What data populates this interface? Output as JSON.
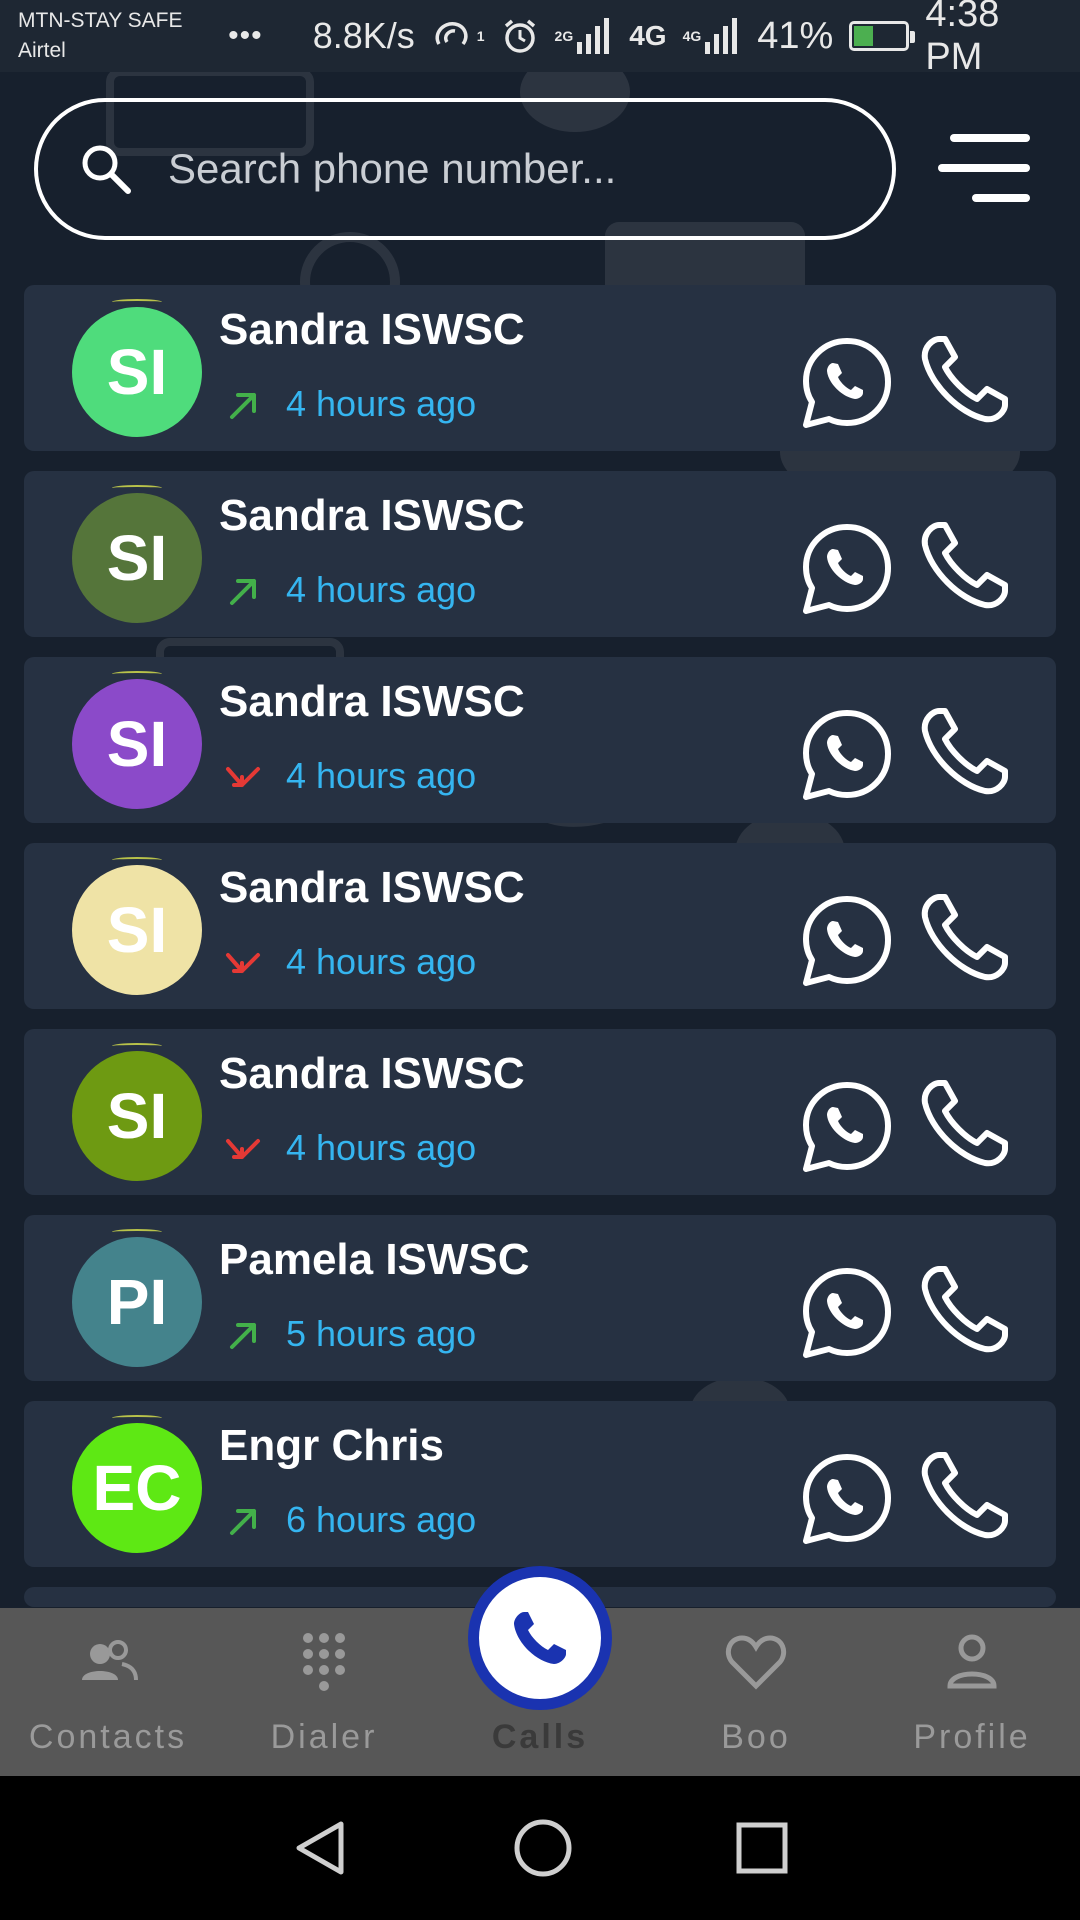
{
  "status_bar": {
    "carrier_line1": "MTN-STAY SAFE",
    "carrier_line2": "Airtel",
    "dots": "•••",
    "speed": "8.8K/s",
    "sim_badge": "1",
    "net1": "2G",
    "net2": "4G",
    "net3": "4G",
    "battery": "41%",
    "battery_level": 0.41,
    "time": "4:38 PM"
  },
  "search": {
    "placeholder": "Search phone number..."
  },
  "calls": [
    {
      "initials": "SI",
      "name": "Sandra ISWSC",
      "time": "4 hours ago",
      "direction": "outgoing",
      "avatar_color": "#4fdc7c"
    },
    {
      "initials": "SI",
      "name": "Sandra ISWSC",
      "time": "4 hours ago",
      "direction": "outgoing",
      "avatar_color": "#55753a"
    },
    {
      "initials": "SI",
      "name": "Sandra ISWSC",
      "time": "4 hours ago",
      "direction": "missed",
      "avatar_color": "#8b4ac9"
    },
    {
      "initials": "SI",
      "name": "Sandra ISWSC",
      "time": "4 hours ago",
      "direction": "missed",
      "avatar_color": "#efe3a6"
    },
    {
      "initials": "SI",
      "name": "Sandra ISWSC",
      "time": "4 hours ago",
      "direction": "missed",
      "avatar_color": "#6e9a12"
    },
    {
      "initials": "PI",
      "name": "Pamela ISWSC",
      "time": "5 hours ago",
      "direction": "outgoing",
      "avatar_color": "#44838c"
    },
    {
      "initials": "EC",
      "name": "Engr Chris",
      "time": "6 hours ago",
      "direction": "outgoing",
      "avatar_color": "#5ee814"
    }
  ],
  "colors": {
    "outgoing": "#43b04a",
    "missed": "#e53935",
    "time_text": "#35b5f0",
    "fab_ring": "#1a33b0"
  },
  "nav": {
    "contacts": "Contacts",
    "dialer": "Dialer",
    "calls": "Calls",
    "boo": "Boo",
    "profile": "Profile"
  }
}
